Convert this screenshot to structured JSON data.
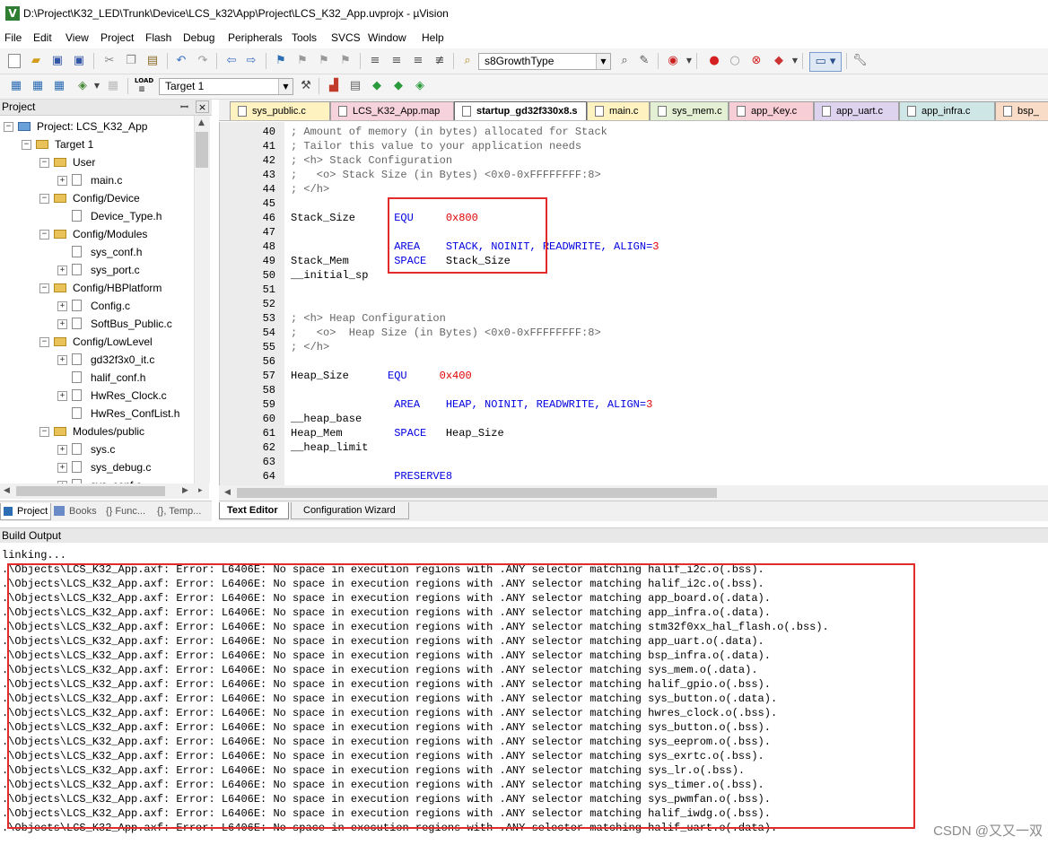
{
  "window": {
    "title": "D:\\Project\\K32_LED\\Trunk\\Device\\LCS_k32\\App\\Project\\LCS_K32_App.uvprojx - µVision",
    "icon": "uvision-app-icon"
  },
  "menu": [
    "File",
    "Edit",
    "View",
    "Project",
    "Flash",
    "Debug",
    "Peripherals",
    "Tools",
    "SVCS",
    "Window",
    "Help"
  ],
  "toolbar": {
    "find_combo": "s8GrowthType",
    "target_combo": "Target 1"
  },
  "project_panel": {
    "title": "Project",
    "pin_glyph": "ᅟ",
    "close_glyph": "×",
    "tree": [
      {
        "label": "Project: LCS_K32_App",
        "level": 0,
        "kind": "project",
        "exp": "−"
      },
      {
        "label": "Target 1",
        "level": 1,
        "kind": "target",
        "exp": "−"
      },
      {
        "label": "User",
        "level": 2,
        "kind": "folder",
        "exp": "−"
      },
      {
        "label": "main.c",
        "level": 3,
        "kind": "file",
        "exp": "+"
      },
      {
        "label": "Config/Device",
        "level": 2,
        "kind": "folder",
        "exp": "−"
      },
      {
        "label": "Device_Type.h",
        "level": 3,
        "kind": "file",
        "exp": ""
      },
      {
        "label": "Config/Modules",
        "level": 2,
        "kind": "folder",
        "exp": "−"
      },
      {
        "label": "sys_conf.h",
        "level": 3,
        "kind": "file",
        "exp": ""
      },
      {
        "label": "sys_port.c",
        "level": 3,
        "kind": "file",
        "exp": "+"
      },
      {
        "label": "Config/HBPlatform",
        "level": 2,
        "kind": "folder",
        "exp": "−"
      },
      {
        "label": "Config.c",
        "level": 3,
        "kind": "file",
        "exp": "+"
      },
      {
        "label": "SoftBus_Public.c",
        "level": 3,
        "kind": "file",
        "exp": "+"
      },
      {
        "label": "Config/LowLevel",
        "level": 2,
        "kind": "folder",
        "exp": "−"
      },
      {
        "label": "gd32f3x0_it.c",
        "level": 3,
        "kind": "file",
        "exp": "+"
      },
      {
        "label": "halif_conf.h",
        "level": 3,
        "kind": "file",
        "exp": ""
      },
      {
        "label": "HwRes_Clock.c",
        "level": 3,
        "kind": "file",
        "exp": "+"
      },
      {
        "label": "HwRes_ConfList.h",
        "level": 3,
        "kind": "file",
        "exp": ""
      },
      {
        "label": "Modules/public",
        "level": 2,
        "kind": "folder",
        "exp": "−"
      },
      {
        "label": "sys.c",
        "level": 3,
        "kind": "file",
        "exp": "+"
      },
      {
        "label": "sys_debug.c",
        "level": 3,
        "kind": "file",
        "exp": "+"
      },
      {
        "label": "sys_conf.c",
        "level": 3,
        "kind": "file",
        "exp": "+"
      }
    ],
    "bottom_tabs": [
      "Project",
      "Books",
      "{} Func...",
      "{}, Temp..."
    ]
  },
  "editor": {
    "tabs": [
      {
        "label": "sys_public.c",
        "color": "#fdf2c0",
        "active": false
      },
      {
        "label": "LCS_K32_App.map",
        "color": "#f6d3dc",
        "active": false
      },
      {
        "label": "startup_gd32f330x8.s",
        "color": "#ffffff",
        "active": true
      },
      {
        "label": "main.c",
        "color": "#fdf2c0",
        "active": false
      },
      {
        "label": "sys_mem.c",
        "color": "#e3f0d4",
        "active": false
      },
      {
        "label": "app_Key.c",
        "color": "#f7cdd6",
        "active": false
      },
      {
        "label": "app_uart.c",
        "color": "#ddd3ee",
        "active": false
      },
      {
        "label": "app_infra.c",
        "color": "#cfe6e6",
        "active": false
      },
      {
        "label": "bsp_",
        "color": "#f9dcc7",
        "active": false
      }
    ],
    "bottom_tabs": [
      "Text Editor",
      "Configuration Wizard"
    ],
    "lines": [
      {
        "n": "40",
        "parts": [
          {
            "t": "; Amount of memory (in bytes) allocated for Stack",
            "c": "cmt"
          }
        ]
      },
      {
        "n": "41",
        "parts": [
          {
            "t": "; Tailor this value to your application needs",
            "c": "cmt"
          }
        ]
      },
      {
        "n": "42",
        "parts": [
          {
            "t": "; <h> Stack Configuration",
            "c": "cmt"
          }
        ]
      },
      {
        "n": "43",
        "parts": [
          {
            "t": ";   <o> Stack Size (in Bytes) <0x0-0xFFFFFFFF:8>",
            "c": "cmt"
          }
        ]
      },
      {
        "n": "44",
        "parts": [
          {
            "t": "; </h>",
            "c": "cmt"
          }
        ]
      },
      {
        "n": "45",
        "parts": []
      },
      {
        "n": "46",
        "parts": [
          {
            "t": "Stack_Size      ",
            "c": "txt"
          },
          {
            "t": "EQU     ",
            "c": "kw"
          },
          {
            "t": "0x800",
            "c": "num"
          }
        ]
      },
      {
        "n": "47",
        "parts": []
      },
      {
        "n": "48",
        "parts": [
          {
            "t": "                ",
            "c": "txt"
          },
          {
            "t": "AREA    STACK, NOINIT, READWRITE, ALIGN=",
            "c": "kw"
          },
          {
            "t": "3",
            "c": "num"
          }
        ]
      },
      {
        "n": "49",
        "parts": [
          {
            "t": "Stack_Mem       ",
            "c": "txt"
          },
          {
            "t": "SPACE   ",
            "c": "kw"
          },
          {
            "t": "Stack_Size",
            "c": "txt"
          }
        ]
      },
      {
        "n": "50",
        "parts": [
          {
            "t": "__initial_sp",
            "c": "txt"
          }
        ]
      },
      {
        "n": "51",
        "parts": []
      },
      {
        "n": "52",
        "parts": []
      },
      {
        "n": "53",
        "parts": [
          {
            "t": "; <h> Heap Configuration",
            "c": "cmt"
          }
        ]
      },
      {
        "n": "54",
        "parts": [
          {
            "t": ";   <o>  Heap Size (in Bytes) <0x0-0xFFFFFFFF:8>",
            "c": "cmt"
          }
        ]
      },
      {
        "n": "55",
        "parts": [
          {
            "t": "; </h>",
            "c": "cmt"
          }
        ]
      },
      {
        "n": "56",
        "parts": []
      },
      {
        "n": "57",
        "parts": [
          {
            "t": "Heap_Size      ",
            "c": "txt"
          },
          {
            "t": "EQU     ",
            "c": "kw"
          },
          {
            "t": "0x400",
            "c": "num"
          }
        ]
      },
      {
        "n": "58",
        "parts": []
      },
      {
        "n": "59",
        "parts": [
          {
            "t": "                ",
            "c": "txt"
          },
          {
            "t": "AREA    HEAP, NOINIT, READWRITE, ALIGN=",
            "c": "kw"
          },
          {
            "t": "3",
            "c": "num"
          }
        ]
      },
      {
        "n": "60",
        "parts": [
          {
            "t": "__heap_base",
            "c": "txt"
          }
        ]
      },
      {
        "n": "61",
        "parts": [
          {
            "t": "Heap_Mem        ",
            "c": "txt"
          },
          {
            "t": "SPACE   ",
            "c": "kw"
          },
          {
            "t": "Heap_Size",
            "c": "txt"
          }
        ]
      },
      {
        "n": "62",
        "parts": [
          {
            "t": "__heap_limit",
            "c": "txt"
          }
        ]
      },
      {
        "n": "63",
        "parts": []
      },
      {
        "n": "64",
        "parts": [
          {
            "t": "                ",
            "c": "txt"
          },
          {
            "t": "PRESERVE8",
            "c": "kw"
          }
        ]
      }
    ]
  },
  "build_output": {
    "title": "Build Output",
    "lines": [
      "linking...",
      ".\\Objects\\LCS_K32_App.axf: Error: L6406E: No space in execution regions with .ANY selector matching halif_i2c.o(.bss).",
      ".\\Objects\\LCS_K32_App.axf: Error: L6406E: No space in execution regions with .ANY selector matching halif_i2c.o(.bss).",
      ".\\Objects\\LCS_K32_App.axf: Error: L6406E: No space in execution regions with .ANY selector matching app_board.o(.data).",
      ".\\Objects\\LCS_K32_App.axf: Error: L6406E: No space in execution regions with .ANY selector matching app_infra.o(.data).",
      ".\\Objects\\LCS_K32_App.axf: Error: L6406E: No space in execution regions with .ANY selector matching stm32f0xx_hal_flash.o(.bss).",
      ".\\Objects\\LCS_K32_App.axf: Error: L6406E: No space in execution regions with .ANY selector matching app_uart.o(.data).",
      ".\\Objects\\LCS_K32_App.axf: Error: L6406E: No space in execution regions with .ANY selector matching bsp_infra.o(.data).",
      ".\\Objects\\LCS_K32_App.axf: Error: L6406E: No space in execution regions with .ANY selector matching sys_mem.o(.data).",
      ".\\Objects\\LCS_K32_App.axf: Error: L6406E: No space in execution regions with .ANY selector matching halif_gpio.o(.bss).",
      ".\\Objects\\LCS_K32_App.axf: Error: L6406E: No space in execution regions with .ANY selector matching sys_button.o(.data).",
      ".\\Objects\\LCS_K32_App.axf: Error: L6406E: No space in execution regions with .ANY selector matching hwres_clock.o(.bss).",
      ".\\Objects\\LCS_K32_App.axf: Error: L6406E: No space in execution regions with .ANY selector matching sys_button.o(.bss).",
      ".\\Objects\\LCS_K32_App.axf: Error: L6406E: No space in execution regions with .ANY selector matching sys_eeprom.o(.bss).",
      ".\\Objects\\LCS_K32_App.axf: Error: L6406E: No space in execution regions with .ANY selector matching sys_exrtc.o(.bss).",
      ".\\Objects\\LCS_K32_App.axf: Error: L6406E: No space in execution regions with .ANY selector matching sys_lr.o(.bss).",
      ".\\Objects\\LCS_K32_App.axf: Error: L6406E: No space in execution regions with .ANY selector matching sys_timer.o(.bss).",
      ".\\Objects\\LCS_K32_App.axf: Error: L6406E: No space in execution regions with .ANY selector matching sys_pwmfan.o(.bss).",
      ".\\Objects\\LCS_K32_App.axf: Error: L6406E: No space in execution regions with .ANY selector matching halif_iwdg.o(.bss).",
      ".\\Objects\\LCS_K32_App.axf: Error: L6406E: No space in execution regions with .ANY selector matching halif_uart.o(.data)."
    ]
  },
  "watermark": "CSDN @又又一双",
  "colors": {
    "highlight_box": "#e32b2b",
    "keyword": "#0000e0",
    "number": "#e00000",
    "comment": "#666666"
  }
}
